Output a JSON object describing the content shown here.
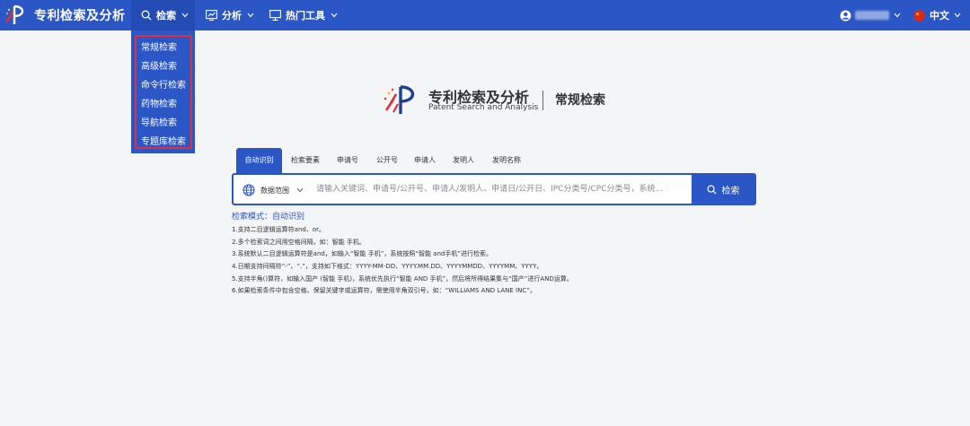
{
  "app": {
    "title": "专利检索及分析"
  },
  "nav": {
    "search_label": "检索",
    "analysis_label": "分析",
    "tools_label": "热门工具"
  },
  "header_right": {
    "language_label": "中文"
  },
  "search_menu": {
    "items": [
      {
        "label": "常规检索"
      },
      {
        "label": "高级检索"
      },
      {
        "label": "命令行检索"
      },
      {
        "label": "药物检索"
      },
      {
        "label": "导航检索"
      },
      {
        "label": "专题库检索"
      }
    ]
  },
  "center_logo": {
    "title": "专利检索及分析",
    "subtitle": "Patent Search and Analysis",
    "page_name": "常规检索"
  },
  "tabs": [
    {
      "label": "自动识别",
      "active": true
    },
    {
      "label": "检索要素"
    },
    {
      "label": "申请号"
    },
    {
      "label": "公开号"
    },
    {
      "label": "申请人"
    },
    {
      "label": "发明人"
    },
    {
      "label": "发明名称"
    }
  ],
  "search": {
    "scope_label": "数据范围",
    "placeholder": "请输入关键词、申请号/公开号、申请人/发明人、申请日/公开日、IPC分类号/CPC分类号，系统...",
    "button_label": "检索"
  },
  "mode_label": "检索模式：自动识别",
  "tips": [
    "1.支持二目逻辑运算符and、or。",
    "2.多个检索词之间用空格间隔，如：智能 手机。",
    "3.系统默认二目逻辑运算符是and，如输入“智能 手机”，系统按照“智能 and手机”进行检索。",
    "4.日期支持间隔符“-”、“.”，支持如下格式：YYYY-MM-DD、YYYY.MM.DD、YYYYMMDD、YYYYMM、YYYY。",
    "5.支持半角()算符，如输入国产 (智能 手机)，系统优先执行“智能 AND 手机”，然后将所得结果集与“国产”进行AND运算。",
    "6.如果检索条件中包含空格、保留关键字或运算符，需使用半角双引号，如：“WILLIAMS AND LANE INC”。"
  ],
  "colors": {
    "primary": "#2b56c6",
    "highlight_border": "#e0313b"
  }
}
